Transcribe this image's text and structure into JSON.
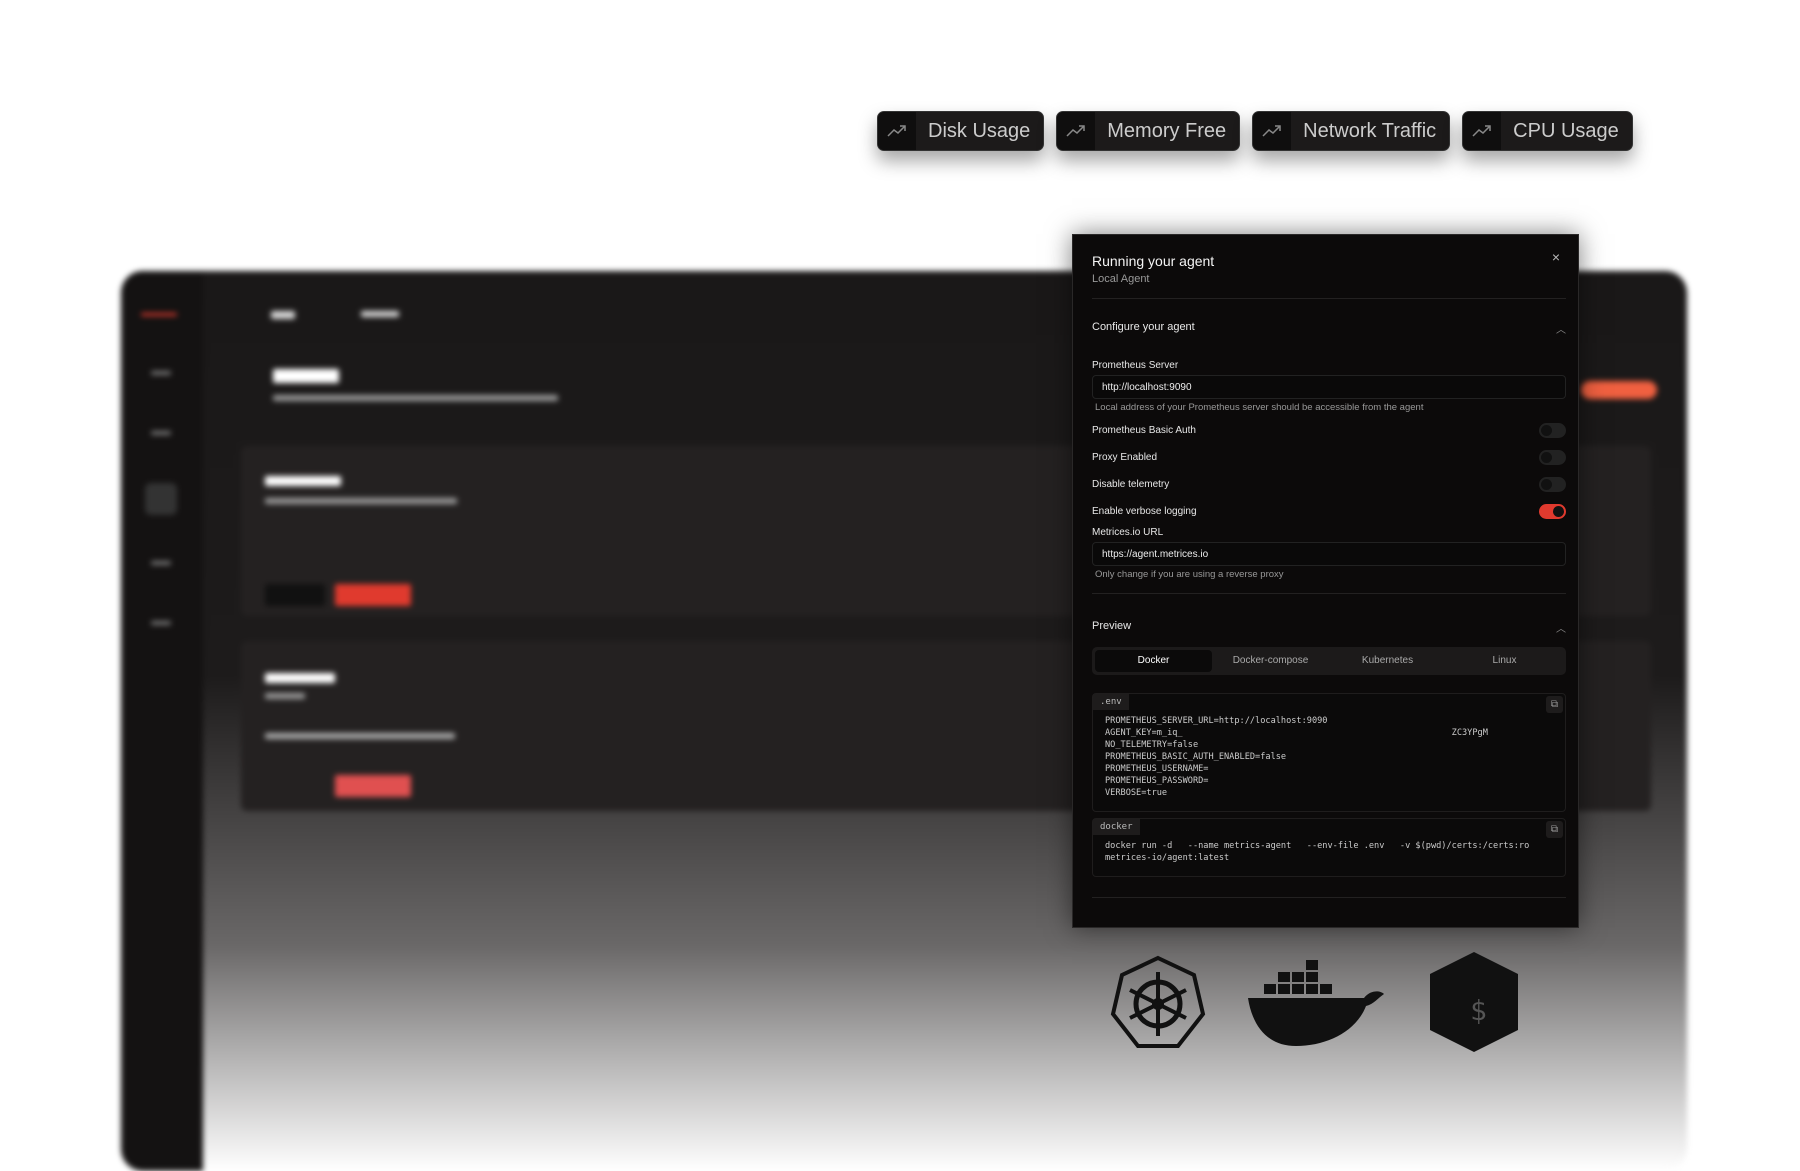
{
  "metric_chips": [
    {
      "label": "Disk Usage",
      "icon": "trending-up-icon"
    },
    {
      "label": "Memory Free",
      "icon": "trending-up-icon"
    },
    {
      "label": "Network Traffic",
      "icon": "trending-up-icon"
    },
    {
      "label": "CPU Usage",
      "icon": "trending-up-icon"
    }
  ],
  "modal": {
    "title": "Running your agent",
    "subtitle": "Local Agent",
    "close": "×",
    "configure": {
      "heading": "Configure your agent",
      "prometheus_server": {
        "label": "Prometheus Server",
        "value": "http://localhost:9090",
        "help": "Local address of your Prometheus server should be accessible from the agent"
      },
      "toggles": [
        {
          "label": "Prometheus Basic Auth",
          "on": false
        },
        {
          "label": "Proxy Enabled",
          "on": false
        },
        {
          "label": "Disable telemetry",
          "on": false
        },
        {
          "label": "Enable verbose logging",
          "on": true
        }
      ],
      "url": {
        "label": "Metrices.io URL",
        "value": "https://agent.metrices.io",
        "help": "Only change if you are using a reverse proxy"
      }
    },
    "preview": {
      "heading": "Preview",
      "tabs": [
        "Docker",
        "Docker-compose",
        "Kubernetes",
        "Linux"
      ],
      "active_tab": "Docker",
      "env": {
        "tag": ".env",
        "code": "PROMETHEUS_SERVER_URL=http://localhost:9090\nAGENT_KEY=m_iq_                                                    ZC3YPgM\nNO_TELEMETRY=false\nPROMETHEUS_BASIC_AUTH_ENABLED=false\nPROMETHEUS_USERNAME=\nPROMETHEUS_PASSWORD=\nVERBOSE=true"
      },
      "docker": {
        "tag": "docker",
        "code": "docker run -d   --name metrics-agent   --env-file .env   -v $(pwd)/certs:/certs:ro\nmetrices-io/agent:latest"
      }
    }
  },
  "accent": "#e03a2e",
  "logos": [
    "kubernetes-logo",
    "docker-logo",
    "bash-logo"
  ]
}
